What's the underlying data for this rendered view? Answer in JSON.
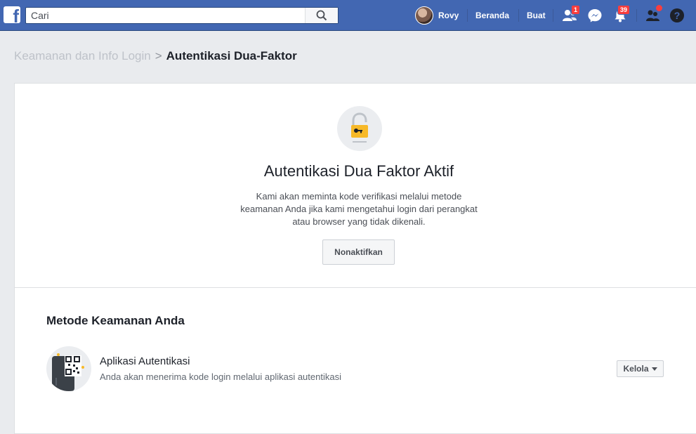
{
  "topbar": {
    "logo_letter": "f",
    "search": {
      "placeholder": "Cari",
      "value": ""
    },
    "user_name": "Rovy",
    "nav": {
      "home": "Beranda",
      "create": "Buat"
    },
    "badges": {
      "friends": "1",
      "notifications": "39"
    },
    "icons": {
      "search": "search-icon",
      "friends": "friend-requests-icon",
      "messenger": "messenger-icon",
      "notifications": "bell-icon",
      "quick_help": "people-icon",
      "help": "question-icon"
    }
  },
  "breadcrumb": {
    "parent": "Keamanan dan Info Login",
    "separator": ">",
    "current": "Autentikasi Dua-Faktor"
  },
  "status": {
    "icon": "lock-key-icon",
    "title": "Autentikasi Dua Faktor Aktif",
    "description": "Kami akan meminta kode verifikasi melalui metode keamanan Anda jika kami mengetahui login dari perangkat atau browser yang tidak dikenali.",
    "disable_button": "Nonaktifkan"
  },
  "methods": {
    "section_title": "Metode Keamanan Anda",
    "items": [
      {
        "icon": "qr-phone-icon",
        "name": "Aplikasi Autentikasi",
        "description": "Anda akan menerima kode login melalui aplikasi autentikasi",
        "manage_button": "Kelola"
      }
    ]
  },
  "colors": {
    "brand": "#4267b2",
    "badge": "#fa3e3e",
    "lock": "#f7b928"
  }
}
